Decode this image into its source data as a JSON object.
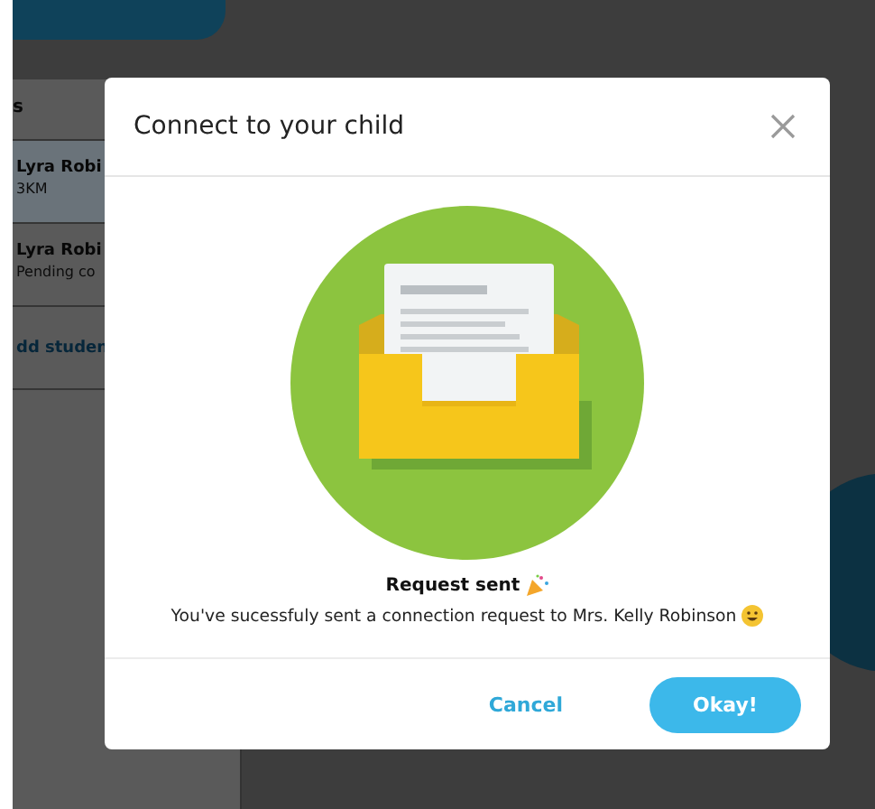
{
  "sidebar": {
    "heading": "s",
    "items": [
      {
        "kind": "student",
        "name": "Lyra Robi",
        "detail": "3KM",
        "selected": true
      },
      {
        "kind": "student",
        "name": "Lyra Robi",
        "detail": "Pending co",
        "selected": false
      },
      {
        "kind": "link",
        "name": "dd studen",
        "selected": false
      }
    ]
  },
  "dialog": {
    "title": "Connect to your child",
    "heading": "Request sent",
    "message": "You've sucessfuly sent a connection request to Mrs. Kelly Robinson",
    "buttons": [
      {
        "kind": "secondary",
        "label": "Cancel"
      },
      {
        "kind": "primary",
        "label": "Okay!"
      }
    ]
  }
}
